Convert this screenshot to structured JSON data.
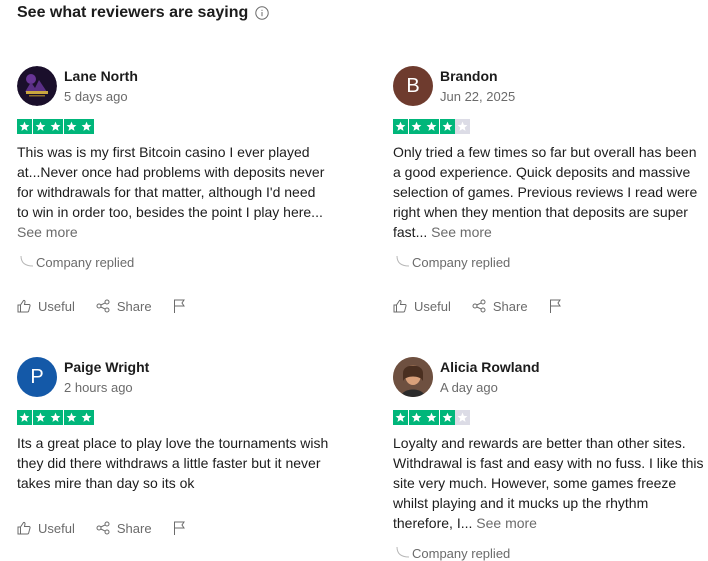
{
  "section": {
    "title": "See what reviewers are saying"
  },
  "colors": {
    "star_on": "#00b67a",
    "star_off": "#dcdce6",
    "muted": "#6b6b6b"
  },
  "common": {
    "useful_label": "Useful",
    "share_label": "Share",
    "company_replied": "Company replied",
    "see_more": "See more"
  },
  "reviews": [
    {
      "name": "Lane North",
      "date": "5 days ago",
      "rating": 5,
      "avatar_letter": "",
      "avatar_color": "#1a0f2b",
      "text": "This was is my first Bitcoin casino I ever played at...Never once had problems with deposits never for withdrawals for that matter, although I'd need to win in order too, besides the point I play here... ",
      "has_reply": true
    },
    {
      "name": "Brandon",
      "date": "Jun 22, 2025",
      "rating": 4,
      "avatar_letter": "B",
      "avatar_color": "#6e3b2e",
      "text": "Only tried a few times so far but overall has been a good experience. Quick deposits and massive selection of games. Previous reviews I read were right when they mention that deposits are super fast... ",
      "has_reply": true
    },
    {
      "name": "Paige Wright",
      "date": "2 hours ago",
      "rating": 5,
      "avatar_letter": "P",
      "avatar_color": "#1459a8",
      "text": "Its a great place to play love the tournaments wish they did there withdraws a little faster but it never takes mire than day so its ok",
      "has_reply": false
    },
    {
      "name": "Alicia Rowland",
      "date": "A day ago",
      "rating": 4,
      "avatar_letter": "",
      "avatar_color": "#8a6a55",
      "text": "Loyalty and rewards are better than other sites. Withdrawal is fast and easy with no fuss. I like this site very much. However, some games freeze whilst playing and it mucks up the rhythm therefore, I... ",
      "has_reply": true
    }
  ]
}
